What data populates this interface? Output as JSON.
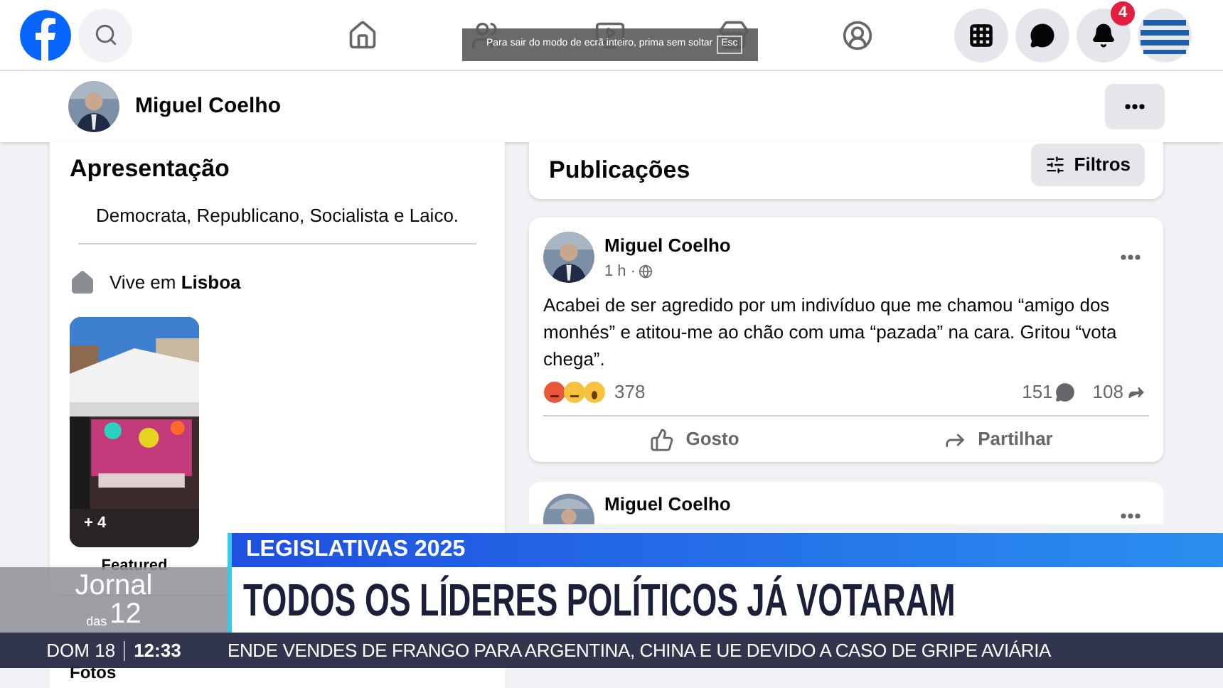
{
  "topbar": {
    "notifications_badge": "4",
    "fullscreen_notice": {
      "text": "Para sair do modo de ecrã inteiro, prima sem soltar",
      "key": "Esc"
    }
  },
  "profile_header": {
    "name": "Miguel Coelho"
  },
  "intro": {
    "title": "Apresentação",
    "bio": "Democrata, Republicano, Socialista e Laico.",
    "lives_in": "Vive em **Lisboa**",
    "featured": {
      "more_count": "+ 4",
      "label": "Featured"
    }
  },
  "photos": {
    "title": "Fotos"
  },
  "posts_header": {
    "title": "Publicações",
    "filter_button": "Filtros"
  },
  "posts": [
    {
      "author": "Miguel Coelho",
      "time": "1 h ·",
      "text": "Acabei de ser agredido por um indivíduo que me chamou “amigo dos monhés” e atitou-me ao chão com uma “pazada” na cara. Gritou “vota chega”.",
      "reactions_count": "378",
      "comments": "151",
      "shares": "108",
      "actions": [
        "Gosto",
        "Partilhar"
      ]
    },
    {
      "author": "Miguel Coelho"
    }
  ],
  "broadcast": {
    "category": "LEGISLATIVAS 2025",
    "headline": "TODOS OS LÍDERES POLÍTICOS JÁ VOTARAM",
    "show_logo": {
      "line1": "Jornal",
      "line2": "das",
      "line3": "12"
    },
    "date": "DOM 18",
    "time": "12:33",
    "ticker": "ENDE VENDES DE FRANGO PARA ARGENTINA, CHINA E UE DEVIDO A CASO DE GRIPE AVIÁRIA"
  }
}
